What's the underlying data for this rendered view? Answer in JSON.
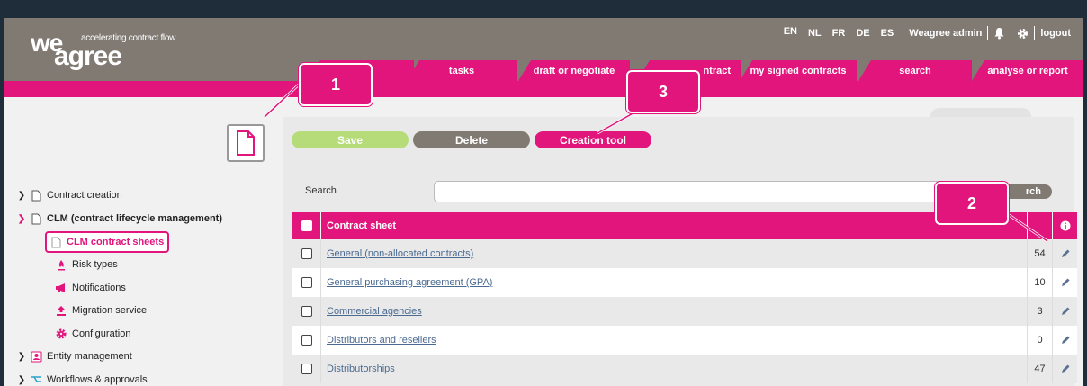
{
  "brand": {
    "logo_top": "we",
    "logo_bottom": "agree",
    "tagline": "accelerating contract flow"
  },
  "topbar": {
    "languages": [
      "EN",
      "NL",
      "FR",
      "DE",
      "ES"
    ],
    "active_language": "EN",
    "user": "Weagree admin",
    "logout": "logout",
    "bell_icon": "bell-icon",
    "settings_icon": "gear-icon"
  },
  "nav_tabs": [
    {
      "label": ""
    },
    {
      "label": "tasks"
    },
    {
      "label": "draft or negotiate"
    },
    {
      "label": "ntract"
    },
    {
      "label": "my signed contracts"
    },
    {
      "label": "search"
    },
    {
      "label": "analyse or report"
    }
  ],
  "sidebar": {
    "items": [
      {
        "label": "Contract creation",
        "icon": "document-icon",
        "expanded": false
      },
      {
        "label": "CLM (contract lifecycle management)",
        "icon": "document-icon",
        "expanded": true
      },
      {
        "label": "CLM contract sheets",
        "icon": "document-icon",
        "selected": true
      },
      {
        "label": "Risk types",
        "icon": "fire-icon"
      },
      {
        "label": "Notifications",
        "icon": "megaphone-icon"
      },
      {
        "label": "Migration service",
        "icon": "upload-icon"
      },
      {
        "label": "Configuration",
        "icon": "cog-icon"
      },
      {
        "label": "Entity management",
        "icon": "user-card-icon",
        "expanded": false
      },
      {
        "label": "Workflows & approvals",
        "icon": "workflow-icon",
        "expanded": false
      }
    ]
  },
  "toolbar": {
    "save_label": "Save",
    "delete_label": "Delete",
    "creation_tool_label": "Creation tool"
  },
  "search": {
    "label": "Search",
    "value": "",
    "button_label": "rch"
  },
  "table": {
    "header": {
      "name": "Contract sheet",
      "info_icon": "info-icon"
    },
    "rows": [
      {
        "name": "General (non-allocated contracts)",
        "count": "54"
      },
      {
        "name": "General purchasing agreement (GPA)",
        "count": "10"
      },
      {
        "name": "Commercial agencies",
        "count": "3"
      },
      {
        "name": "Distributors and resellers",
        "count": "0"
      },
      {
        "name": "Distributorships",
        "count": "47"
      }
    ]
  },
  "callouts": {
    "c1": "1",
    "c2": "2",
    "c3": "3"
  },
  "colors": {
    "accent": "#e1157b",
    "header_gray": "#807a73",
    "save_green": "#b6dc7a",
    "link": "#4a6a90"
  }
}
